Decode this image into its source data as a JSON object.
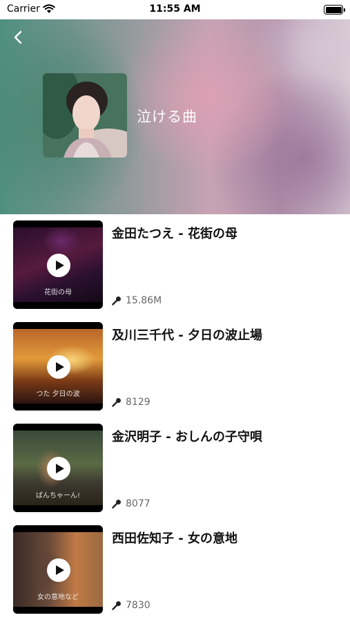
{
  "status_bar": {
    "carrier": "Carrier",
    "time": "11:55 AM"
  },
  "header": {
    "title": "泣ける曲",
    "back_icon": "chevron-left-icon"
  },
  "songs": [
    {
      "title": "金田たつえ - 花街の母",
      "plays": "15.86M",
      "caption": "花街の母"
    },
    {
      "title": "及川三千代 - 夕日の波止場",
      "plays": "8129",
      "caption": "つた 夕日の波"
    },
    {
      "title": "金沢明子 - おしんの子守唄",
      "plays": "8077",
      "caption": "ばんちゃーん!"
    },
    {
      "title": "西田佐知子 - 女の意地",
      "plays": "7830",
      "caption": "女の意地など"
    }
  ],
  "icons": {
    "play": "play-icon",
    "microphone": "microphone-icon"
  },
  "colors": {
    "background": "#ffffff",
    "title_text": "#111111",
    "stats_text": "#666666",
    "header_teal": "#4f8f7d",
    "header_pink": "#c7a2b4"
  }
}
